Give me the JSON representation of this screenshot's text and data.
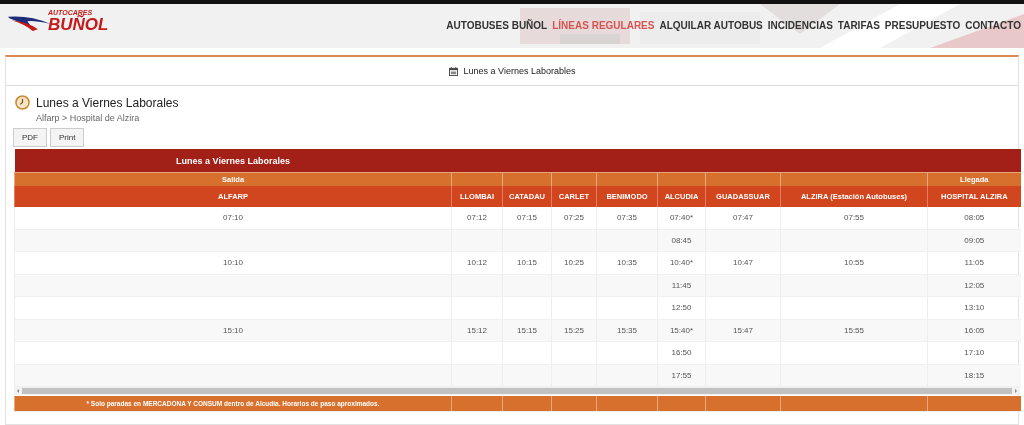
{
  "header": {
    "logo_small": "AUTOCARES",
    "logo": "BUÑOL",
    "nav": [
      {
        "label": "AUTOBUSES BUÑOL",
        "selected": false
      },
      {
        "label": "LÍNEAS REGULARES",
        "selected": true
      },
      {
        "label": "ALQUILAR AUTOBUS",
        "selected": false
      },
      {
        "label": "INCIDENCIAS",
        "selected": false
      },
      {
        "label": "TARIFAS",
        "selected": false
      },
      {
        "label": "PRESUPUESTO",
        "selected": false
      },
      {
        "label": "CONTACTO",
        "selected": false
      }
    ]
  },
  "tabs": [
    {
      "label": "Lunes a Viernes Laborables",
      "selected": true
    }
  ],
  "schedule": {
    "title": "Lunes a Viernes Laborales",
    "breadcrumb": "Alfarp > Hospital de Alzira",
    "buttons": [
      "PDF",
      "Print"
    ]
  },
  "table": {
    "title": "Lunes a Viernes Laborales",
    "origin_label": "Salida",
    "destination_label": "Llegada",
    "columns": [
      "ALFARP",
      "LLOMBAI",
      "CATADAU",
      "CARLET",
      "BENIMODO",
      "ALCUDIA",
      "GUADASSUAR",
      "ALZIRA (Estación Autobuses)",
      "HOSPITAL ALZIRA"
    ],
    "rows": [
      [
        "07:10",
        "07:12",
        "07:15",
        "07:25",
        "07:35",
        "07:40*",
        "07:47",
        "07:55",
        "08:05"
      ],
      [
        null,
        null,
        null,
        null,
        null,
        "08:45",
        null,
        null,
        "09:05"
      ],
      [
        "10:10",
        "10:12",
        "10:15",
        "10:25",
        "10:35",
        "10:40*",
        "10:47",
        "10:55",
        "11:05"
      ],
      [
        null,
        null,
        null,
        null,
        null,
        "11:45",
        null,
        null,
        "12:05"
      ],
      [
        null,
        null,
        null,
        null,
        null,
        "12:50",
        null,
        null,
        "13:10"
      ],
      [
        "15:10",
        "15:12",
        "15:15",
        "15:25",
        "15:35",
        "15:40*",
        "15:47",
        "15:55",
        "16:05"
      ],
      [
        null,
        null,
        null,
        null,
        null,
        "16:50",
        null,
        null,
        "17:10"
      ],
      [
        null,
        null,
        null,
        null,
        null,
        "17:55",
        null,
        null,
        "18:15"
      ]
    ],
    "footnote": "* Solo paradas en MERCADONA Y CONSUM dentro de Alcudia. Horarios de paso aproximados."
  }
}
